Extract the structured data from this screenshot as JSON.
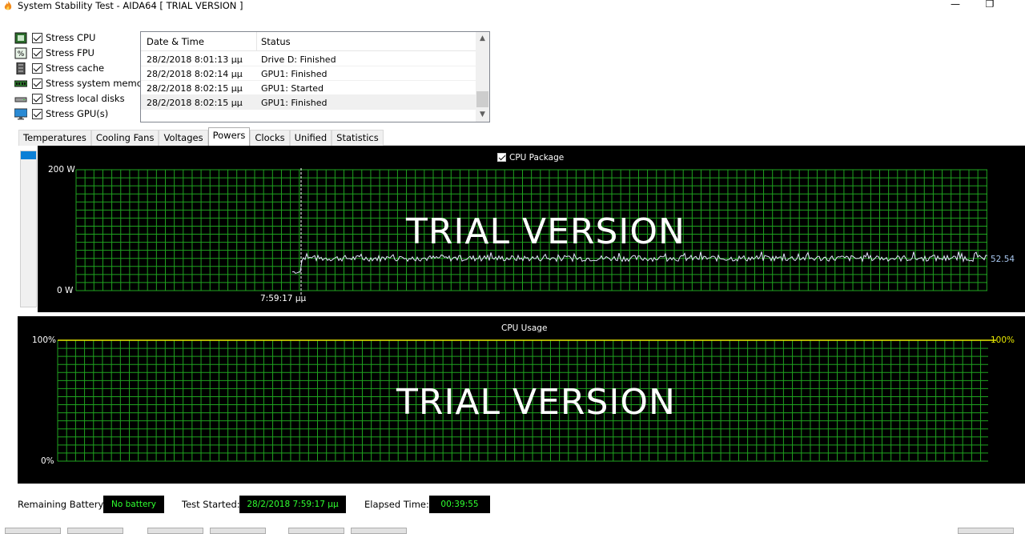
{
  "window": {
    "title": "System Stability Test - AIDA64  [ TRIAL VERSION ]",
    "minimize_glyph": "—",
    "restore_glyph": "❐"
  },
  "stress_options": [
    {
      "label": "Stress CPU",
      "checked": true,
      "icon": "cpu-icon"
    },
    {
      "label": "Stress FPU",
      "checked": true,
      "icon": "fpu-icon"
    },
    {
      "label": "Stress cache",
      "checked": true,
      "icon": "cache-icon"
    },
    {
      "label": "Stress system memory",
      "checked": true,
      "icon": "memory-icon"
    },
    {
      "label": "Stress local disks",
      "checked": true,
      "icon": "disk-icon"
    },
    {
      "label": "Stress GPU(s)",
      "checked": true,
      "icon": "monitor-icon"
    }
  ],
  "log": {
    "col_datetime": "Date & Time",
    "col_status": "Status",
    "rows": [
      {
        "datetime": "28/2/2018 8:01:13 μμ",
        "status": "Drive D: Finished"
      },
      {
        "datetime": "28/2/2018 8:02:14 μμ",
        "status": "GPU1: Finished"
      },
      {
        "datetime": "28/2/2018 8:02:15 μμ",
        "status": "GPU1: Started"
      },
      {
        "datetime": "28/2/2018 8:02:15 μμ",
        "status": "GPU1: Finished"
      }
    ]
  },
  "tabs": [
    {
      "label": "Temperatures",
      "active": false
    },
    {
      "label": "Cooling Fans",
      "active": false
    },
    {
      "label": "Voltages",
      "active": false
    },
    {
      "label": "Powers",
      "active": true
    },
    {
      "label": "Clocks",
      "active": false
    },
    {
      "label": "Unified",
      "active": false
    },
    {
      "label": "Statistics",
      "active": false
    }
  ],
  "power_graph": {
    "legend": "CPU Package",
    "y_max_label": "200 W",
    "y_min_label": "0 W",
    "time_marker": "7:59:17 μμ",
    "current_value": "52.54",
    "watermark": "TRIAL VERSION",
    "grid_color": "#1fa31f",
    "line_color": "#e6e6ff",
    "y_range": [
      0,
      200
    ],
    "series_mean": 52.54
  },
  "usage_graph": {
    "title": "CPU Usage",
    "y_max_left": "100%",
    "y_min_left": "0%",
    "y_max_right": "100%",
    "watermark": "TRIAL VERSION",
    "line_color": "#e8e800",
    "value": 100
  },
  "status_bar": {
    "battery_label": "Remaining Battery:",
    "battery_value": "No battery",
    "started_label": "Test Started:",
    "started_value": "28/2/2018 7:59:17 μμ",
    "elapsed_label": "Elapsed Time:",
    "elapsed_value": "00:39:55"
  }
}
